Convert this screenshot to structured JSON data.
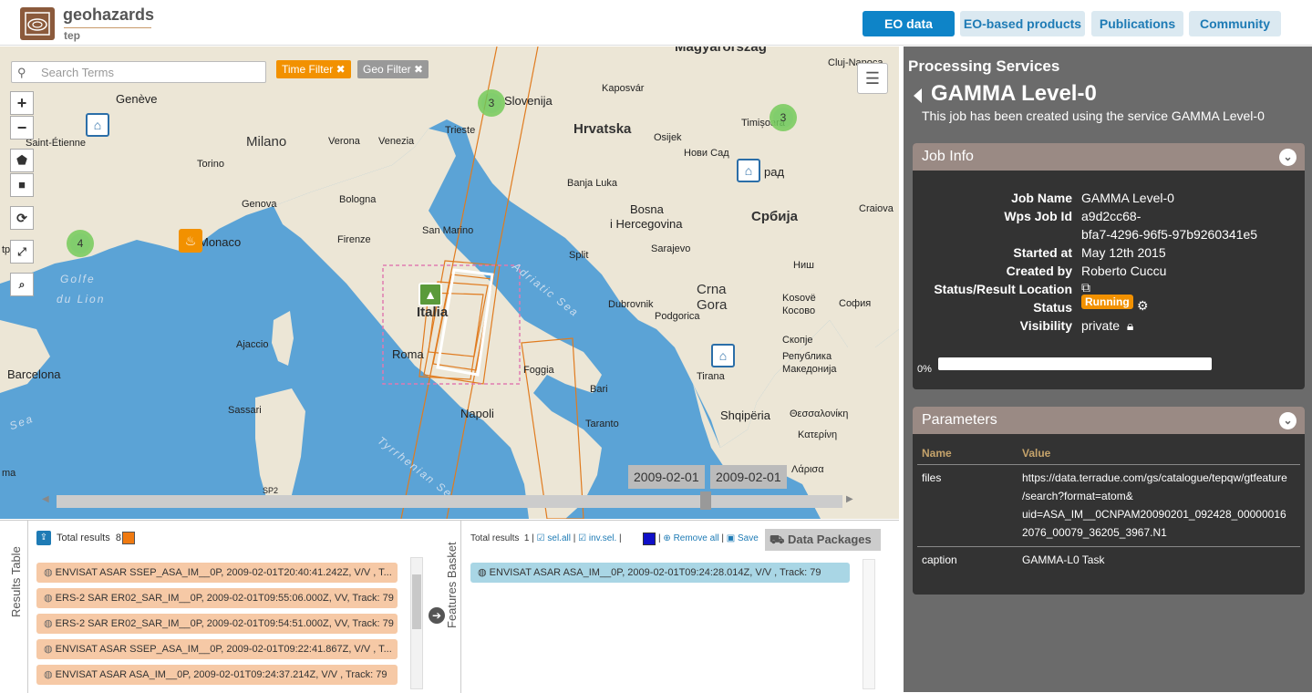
{
  "brand": {
    "name": "geohazards",
    "sub": "tep"
  },
  "nav": [
    {
      "label": "EO data",
      "active": true
    },
    {
      "label": "EO-based products"
    },
    {
      "label": "Publications"
    },
    {
      "label": "Community"
    }
  ],
  "map": {
    "search_placeholder": "Search Terms",
    "time_filter": "Time Filter",
    "geo_filter": "Geo Filter",
    "labels": {
      "magyarorszag": "Magyarország",
      "geneve": "Genève",
      "slovenija": "Slovenija",
      "kaposvar": "Kaposvár",
      "cluj": "Cluj-Napoca",
      "saint_etienne": "Saint-Étienne",
      "milano": "Milano",
      "verona": "Verona",
      "venezia": "Venezia",
      "trieste": "Trieste",
      "hrvatska": "Hrvatska",
      "osijek": "Osijek",
      "timisoara": "Timișoara",
      "torino": "Torino",
      "novi_sad": "Нови Сад",
      "grad": "рад",
      "banja_luka": "Banja Luka",
      "genova": "Genova",
      "bologna": "Bologna",
      "bosna": "Bosna",
      "i_hercegovina": "i Hercegovina",
      "srbija": "Србија",
      "craiova": "Craiova",
      "san_marino": "San Marino",
      "sarajevo": "Sarajevo",
      "montpellier": "tpellier",
      "monaco": "Monaco",
      "firenze": "Firenze",
      "split": "Split",
      "nis": "Ниш",
      "golfe": "Golfe",
      "du_lion": "du Lion",
      "crna": "Crna",
      "gora": "Gora",
      "kosove": "Kosovë",
      "kosovo": "Косово",
      "sofia": "София",
      "italia": "Italia",
      "dubrovnik": "Dubrovnik",
      "podgorica": "Podgorica",
      "adriatic": "Adriatic Sea",
      "ajaccio": "Ajaccio",
      "roma": "Roma",
      "skopje": "Скопје",
      "republika": "Република",
      "makedonija": "Македонија",
      "barcelona": "Barcelona",
      "foggia": "Foggia",
      "tirana": "Tirana",
      "bari": "Bari",
      "sassari": "Sassari",
      "napoli": "Napoli",
      "shqiperia": "Shqipëria",
      "thessaloniki": "Θεσσαλονίκη",
      "taranto": "Taranto",
      "katerini": "Κατερίνη",
      "sea": "Sea",
      "tyrrhenian": "Tyrrhenian Sea",
      "larisa": "Λάρισα",
      "ma": "ma",
      "sp2": "SP2"
    },
    "clusters": [
      {
        "count": "3"
      },
      {
        "count": "3"
      },
      {
        "count": "4"
      }
    ],
    "dates": [
      "2009-02-01",
      "2009-02-01"
    ]
  },
  "results": {
    "tab_label": "Results Table",
    "total_label": "Total results",
    "total": "8",
    "items": [
      "ENVISAT ASAR SSEP_ASA_IM__0P, 2009-02-01T20:40:41.242Z, V/V , T...",
      "ERS-2 SAR ER02_SAR_IM__0P, 2009-02-01T09:55:06.000Z, VV, Track: 79",
      "ERS-2 SAR ER02_SAR_IM__0P, 2009-02-01T09:54:51.000Z, VV, Track: 79",
      "ENVISAT ASAR SSEP_ASA_IM__0P, 2009-02-01T09:22:41.867Z, V/V , T...",
      "ENVISAT ASAR ASA_IM__0P, 2009-02-01T09:24:37.214Z, V/V , Track: 79"
    ]
  },
  "basket": {
    "tab_label": "Features Basket",
    "total_label": "Total results",
    "total": "1",
    "sel_all": "sel.all",
    "inv_sel": "inv.sel.",
    "remove_all": "Remove all",
    "save": "Save",
    "data_packages": "Data Packages",
    "item": "ENVISAT ASAR ASA_IM__0P, 2009-02-01T09:24:28.014Z, V/V , Track: 79"
  },
  "panel": {
    "title": "Processing Services",
    "job_title": "GAMMA Level-0",
    "job_desc": "This job has been created using the service GAMMA Level-0",
    "job_info": {
      "header": "Job Info",
      "job_name_label": "Job Name",
      "job_name": "GAMMA Level-0",
      "wps_label": "Wps Job Id",
      "wps_line1": "a9d2cc68-",
      "wps_line2": "bfa7-4296-96f5-97b9260341e5",
      "started_label": "Started at",
      "started": "May 12th 2015",
      "created_label": "Created by",
      "created": "Roberto Cuccu",
      "location_label": "Status/Result Location",
      "status_label": "Status",
      "status": "Running",
      "visibility_label": "Visibility",
      "visibility": "private",
      "progress_text": "0%",
      "progress": 0
    },
    "parameters": {
      "header": "Parameters",
      "col_name": "Name",
      "col_value": "Value",
      "files_name": "files",
      "files_lines": [
        "https://data.terradue.com/gs/catalogue/tepqw/gtfeature",
        "/search?format=atom&",
        "uid=ASA_IM__0CNPAM20090201_092428_00000016",
        "2076_00079_36205_3967.N1"
      ],
      "caption_name": "caption",
      "caption_value": "GAMMA-L0 Task"
    }
  },
  "colors": {
    "accent": "#0e84c8",
    "orange": "#f29100",
    "result_bg": "#f6c9a6",
    "basket_bg": "#a9d6e5"
  }
}
